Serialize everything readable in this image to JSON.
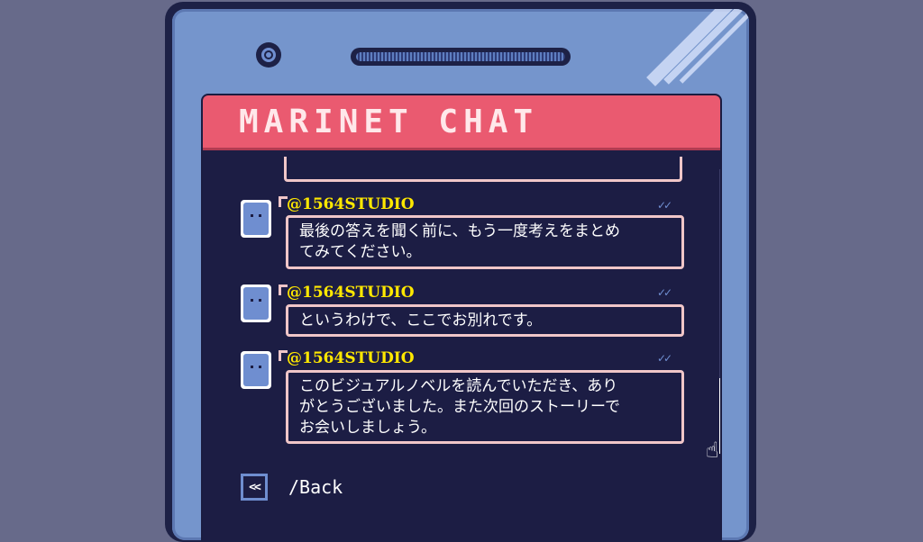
{
  "app": {
    "title": "MARINET CHAT"
  },
  "messages": [
    {
      "user": "@1564STUDIO",
      "text": "最後の答えを聞く前に、もう一度考えをまとめてみてください。",
      "lines": [
        "最後の答えを聞く前に、もう一度考えをまとめ",
        "てみてください。"
      ],
      "read": "✓✓"
    },
    {
      "user": "@1564STUDIO",
      "text": "というわけで、ここでお別れです。",
      "lines": [
        "というわけで、ここでお別れです。"
      ],
      "read": "✓✓"
    },
    {
      "user": "@1564STUDIO",
      "text": "このビジュアルノベルを読んでいただき、ありがとうございました。また次回のストーリーでお会いしましょう。",
      "lines": [
        "このビジュアルノベルを読んでいただき、あり",
        "がとうございました。また次回のストーリーで",
        "お会いしましょう。"
      ],
      "read": "✓✓"
    }
  ],
  "nav": {
    "back_icon": "<<",
    "back_label": "/Back"
  },
  "scrollbar": {
    "position": 1.0
  },
  "icons": [
    "camera-icon",
    "speaker-grille",
    "avatar-icon",
    "read-check-icon",
    "hand-cursor-icon",
    "back-arrow-icon"
  ],
  "colors": {
    "background": "#676a8a",
    "phone": "#7595cc",
    "screen": "#1c1d44",
    "header": "#ea5a70",
    "username": "#ffe800",
    "bubble_border": "#f0c6c8"
  }
}
